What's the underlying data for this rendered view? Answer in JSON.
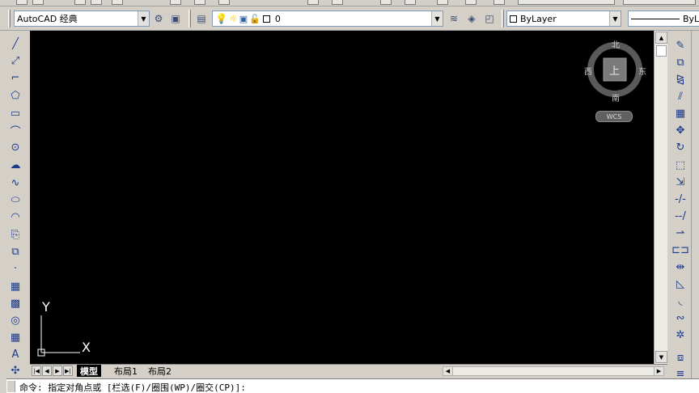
{
  "toolbar": {
    "workspace": "AutoCAD 经典",
    "layer": "0",
    "color": "ByLayer",
    "linetype_partial": "ByL"
  },
  "viewcube": {
    "north": "北",
    "south": "南",
    "east": "东",
    "west": "西",
    "face": "上",
    "coordinate_system": "WCS"
  },
  "ucs": {
    "x_label": "X",
    "y_label": "Y"
  },
  "tabs": [
    {
      "label": "模型",
      "active": true
    },
    {
      "label": "布局1",
      "active": false
    },
    {
      "label": "布局2",
      "active": false
    }
  ],
  "command": {
    "text": "命令: 指定对角点或 [栏选(F)/圈围(WP)/圈交(CP)]:"
  },
  "colors": {
    "canvas": "#000000",
    "chrome": "#d4d0c8",
    "icon": "#1c3a8a"
  }
}
